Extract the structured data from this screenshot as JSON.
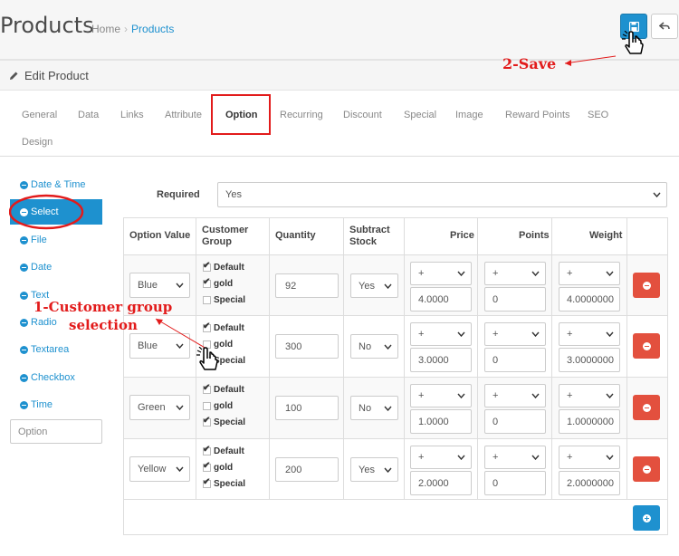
{
  "header": {
    "title": "Products",
    "breadcrumb": [
      "Home",
      "Products"
    ]
  },
  "panel": {
    "heading": "Edit Product"
  },
  "tabs": [
    "General",
    "Data",
    "Links",
    "Attribute",
    "Option",
    "Recurring",
    "Discount",
    "Special",
    "Image",
    "Reward Points",
    "SEO",
    "Design"
  ],
  "active_tab": "Option",
  "options_nav": [
    "Date & Time",
    "Select",
    "File",
    "Date",
    "Text",
    "Radio",
    "Textarea",
    "Checkbox",
    "Time"
  ],
  "selected_option": "Select",
  "option_input_placeholder": "Option",
  "required": {
    "label": "Required",
    "value": "Yes"
  },
  "columns": [
    "Option Value",
    "Customer Group",
    "Quantity",
    "Subtract Stock",
    "Price",
    "Points",
    "Weight"
  ],
  "rows": [
    {
      "value": "Blue",
      "groups": [
        true,
        true,
        false
      ],
      "qty": "92",
      "subtract": "Yes",
      "price_prefix": "+",
      "price": "4.0000",
      "points_prefix": "+",
      "points": "0",
      "weight_prefix": "+",
      "weight": "4.0000000"
    },
    {
      "value": "Blue",
      "groups": [
        true,
        false,
        false
      ],
      "qty": "300",
      "subtract": "No",
      "price_prefix": "+",
      "price": "3.0000",
      "points_prefix": "+",
      "points": "0",
      "weight_prefix": "+",
      "weight": "3.0000000"
    },
    {
      "value": "Green",
      "groups": [
        true,
        false,
        true
      ],
      "qty": "100",
      "subtract": "No",
      "price_prefix": "+",
      "price": "1.0000",
      "points_prefix": "+",
      "points": "0",
      "weight_prefix": "+",
      "weight": "1.0000000"
    },
    {
      "value": "Yellow",
      "groups": [
        true,
        true,
        true
      ],
      "qty": "200",
      "subtract": "Yes",
      "price_prefix": "+",
      "price": "2.0000",
      "points_prefix": "+",
      "points": "0",
      "weight_prefix": "+",
      "weight": "2.0000000"
    }
  ],
  "group_labels": [
    "Default",
    "gold",
    "Special"
  ],
  "annotations": {
    "save": "2-Save",
    "group_line1": "1-Customer group",
    "group_line2": "selection"
  },
  "colors": {
    "primary": "#1e91cf",
    "danger": "#e3503e",
    "annotation": "#e21b1b"
  }
}
